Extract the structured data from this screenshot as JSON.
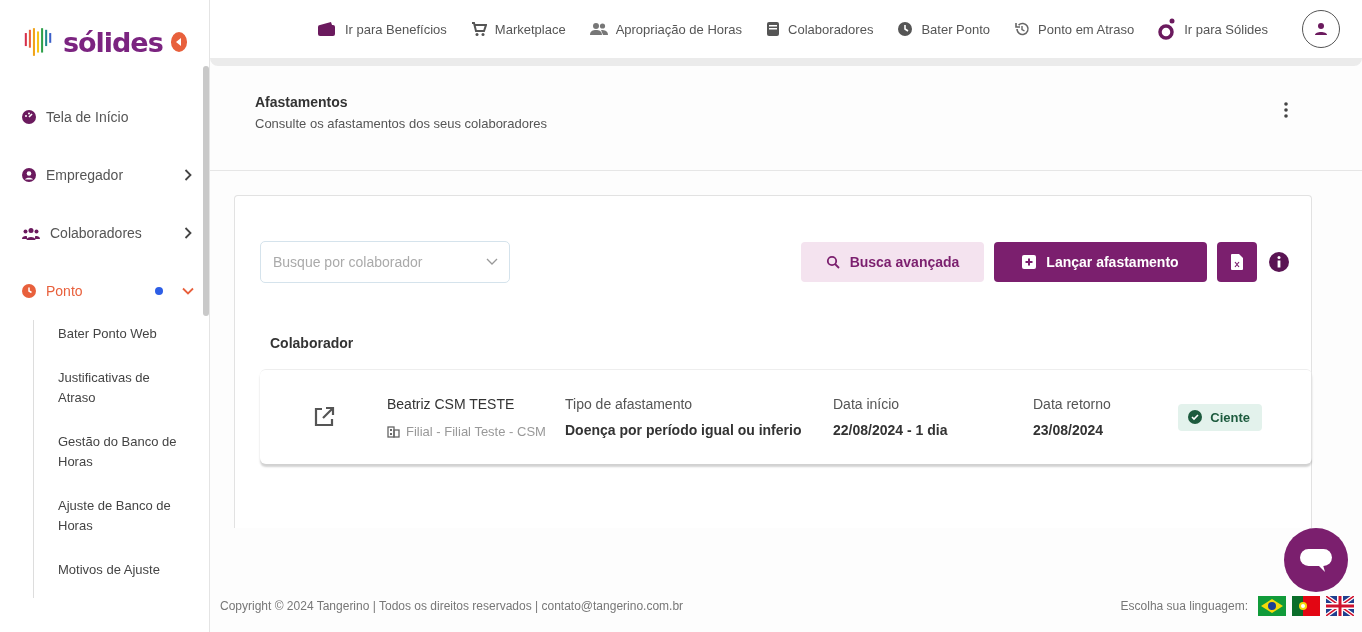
{
  "sidebar": {
    "logo": "sólides",
    "items": [
      {
        "label": "Tela de Início",
        "kind": "link",
        "selected": false,
        "notification": false
      },
      {
        "label": "Empregador",
        "kind": "group",
        "selected": false,
        "expanded": false,
        "notification": false
      },
      {
        "label": "Colaboradores",
        "kind": "group",
        "selected": false,
        "expanded": false,
        "notification": false
      },
      {
        "label": "Ponto",
        "kind": "group",
        "selected": true,
        "expanded": true,
        "notification": true,
        "children": [
          {
            "label": "Bater Ponto Web"
          },
          {
            "label": "Justificativas de Atraso"
          },
          {
            "label": "Gestão do Banco de Horas"
          },
          {
            "label": "Ajuste de Banco de Horas"
          },
          {
            "label": "Motivos de Ajuste"
          }
        ]
      }
    ]
  },
  "top_nav": [
    "Ir para Benefícios",
    "Marketplace",
    "Apropriação de Horas",
    "Colaboradores",
    "Bater Ponto",
    "Ponto em Atraso",
    "Ir para Sólides"
  ],
  "page": {
    "title": "Afastamentos",
    "subtitle": "Consulte os afastamentos dos seus colaboradores"
  },
  "search": {
    "placeholder": "Busque por colaborador"
  },
  "buttons": {
    "advanced_search": "Busca avançada",
    "add": "Lançar afastamento"
  },
  "table": {
    "columns": [
      "Colaborador"
    ],
    "rows": [
      {
        "name": "Beatriz CSM TESTE",
        "branch": "Filial - Filial Teste - CSM",
        "fields": [
          {
            "label": "Tipo de afastamento",
            "value": "Doença por período igual ou inferio"
          },
          {
            "label": "Data início",
            "value": "22/08/2024 - 1 dia"
          },
          {
            "label": "Data retorno",
            "value": "23/08/2024"
          }
        ],
        "status": "Ciente"
      }
    ]
  },
  "footer": {
    "copyright": "Copyright © 2024 Tangerino | Todos os direitos reservados | contato@tangerino.com.br",
    "language_label": "Escolha sua linguagem:"
  }
}
